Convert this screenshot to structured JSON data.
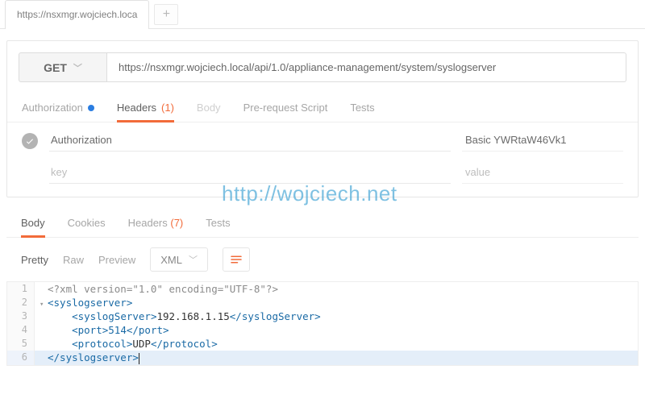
{
  "tabs": {
    "main": "https://nsxmgr.wojciech.loca",
    "add": "+"
  },
  "request": {
    "method": "GET",
    "url": "https://nsxmgr.wojciech.local/api/1.0/appliance-management/system/syslogserver",
    "tabs": {
      "authorization": "Authorization",
      "headers": "Headers",
      "headers_count": "(1)",
      "body": "Body",
      "prerequest": "Pre-request Script",
      "tests": "Tests"
    },
    "headers_row": {
      "key": "Authorization",
      "value": "Basic YWRtaW46Vk1",
      "key_placeholder": "key",
      "value_placeholder": "value"
    }
  },
  "response": {
    "tabs": {
      "body": "Body",
      "cookies": "Cookies",
      "headers": "Headers",
      "headers_count": "(7)",
      "tests": "Tests"
    },
    "view": {
      "pretty": "Pretty",
      "raw": "Raw",
      "preview": "Preview",
      "format": "XML"
    }
  },
  "xml": {
    "l1": "<?xml version=\"1.0\" encoding=\"UTF-8\"?>",
    "l2_open": "<syslogserver>",
    "l3_open": "<syslogServer>",
    "l3_text": "192.168.1.15",
    "l3_close": "</syslogServer>",
    "l4_open": "<port>",
    "l4_text": "514",
    "l4_close": "</port>",
    "l5_open": "<protocol>",
    "l5_text": "UDP",
    "l5_close": "</protocol>",
    "l6_close": "</syslogserver>"
  },
  "watermark": "http://wojciech.net"
}
